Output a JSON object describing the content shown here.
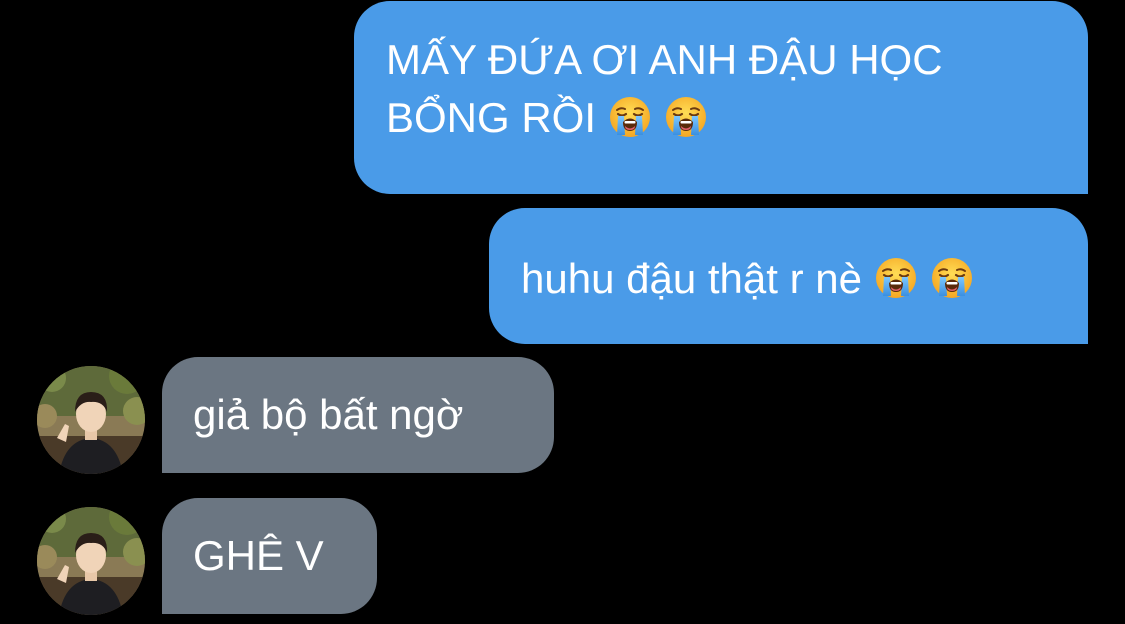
{
  "thread": {
    "messages": [
      {
        "direction": "outgoing",
        "line1": "MẤY ĐỨA ƠI ANH ĐẬU HỌC",
        "line2": "BỔNG RỒI",
        "emoji": [
          "loudly-crying-face",
          "loudly-crying-face"
        ]
      },
      {
        "direction": "outgoing",
        "text": "huhu đậu thật r nè",
        "emoji": [
          "loudly-crying-face",
          "loudly-crying-face"
        ]
      },
      {
        "direction": "incoming",
        "text": "giả bộ bất ngờ"
      },
      {
        "direction": "incoming",
        "text": "GHÊ V"
      }
    ]
  },
  "colors": {
    "background": "#000000",
    "outgoing_bubble": "#4a9be8",
    "incoming_bubble": "#6b7682",
    "text": "#ffffff"
  }
}
